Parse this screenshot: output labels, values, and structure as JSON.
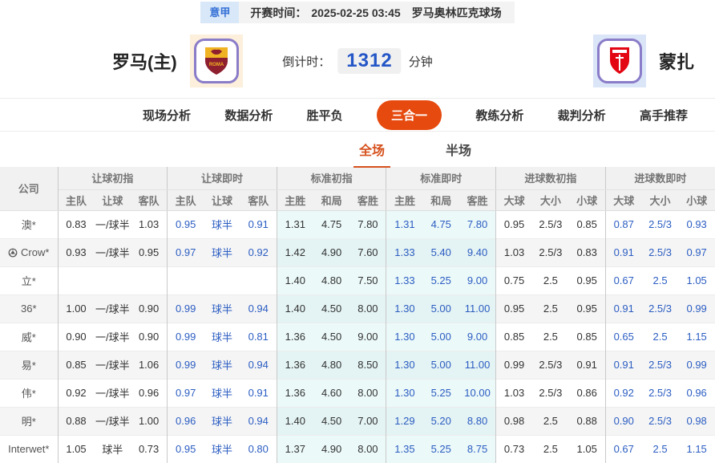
{
  "top_bar": {
    "league": "意甲",
    "kickoff_label": "开赛时间：",
    "kickoff_time": "2025-02-25 03:45",
    "venue": "罗马奥林匹克球场"
  },
  "header": {
    "home_team": "罗马(主)",
    "away_team": "蒙扎",
    "countdown_label": "倒计时：",
    "countdown_value": "1312",
    "countdown_unit": "分钟"
  },
  "nav": {
    "items": [
      {
        "label": "现场分析",
        "active": false
      },
      {
        "label": "数据分析",
        "active": false
      },
      {
        "label": "胜平负",
        "active": false
      },
      {
        "label": "三合一",
        "active": true
      },
      {
        "label": "教练分析",
        "active": false
      },
      {
        "label": "裁判分析",
        "active": false
      },
      {
        "label": "高手推荐",
        "active": false
      }
    ]
  },
  "sub_tabs": {
    "items": [
      {
        "label": "全场",
        "active": true
      },
      {
        "label": "半场",
        "active": false
      }
    ]
  },
  "odds_table": {
    "company_header": "公司",
    "groups": [
      {
        "label": "让球初指",
        "cols": [
          "主队",
          "让球",
          "客队"
        ],
        "live": false,
        "cyan": false
      },
      {
        "label": "让球即时",
        "cols": [
          "主队",
          "让球",
          "客队"
        ],
        "live": true,
        "cyan": false
      },
      {
        "label": "标准初指",
        "cols": [
          "主胜",
          "和局",
          "客胜"
        ],
        "live": false,
        "cyan": true
      },
      {
        "label": "标准即时",
        "cols": [
          "主胜",
          "和局",
          "客胜"
        ],
        "live": true,
        "cyan": true
      },
      {
        "label": "进球数初指",
        "cols": [
          "大球",
          "大小",
          "小球"
        ],
        "live": false,
        "cyan": false
      },
      {
        "label": "进球数即时",
        "cols": [
          "大球",
          "大小",
          "小球"
        ],
        "live": true,
        "cyan": false
      }
    ],
    "rows": [
      {
        "company": "澳*",
        "icon": "",
        "cells": [
          "0.83",
          "一/球半",
          "1.03",
          "0.95",
          "球半",
          "0.91",
          "1.31",
          "4.75",
          "7.80",
          "1.31",
          "4.75",
          "7.80",
          "0.95",
          "2.5/3",
          "0.85",
          "0.87",
          "2.5/3",
          "0.93"
        ]
      },
      {
        "company": "Crow*",
        "icon": "soccer-ball-icon",
        "cells": [
          "0.93",
          "一/球半",
          "0.95",
          "0.97",
          "球半",
          "0.92",
          "1.42",
          "4.90",
          "7.60",
          "1.33",
          "5.40",
          "9.40",
          "1.03",
          "2.5/3",
          "0.83",
          "0.91",
          "2.5/3",
          "0.97"
        ]
      },
      {
        "company": "立*",
        "icon": "",
        "cells": [
          "",
          "",
          "",
          "",
          "",
          "",
          "1.40",
          "4.80",
          "7.50",
          "1.33",
          "5.25",
          "9.00",
          "0.75",
          "2.5",
          "0.95",
          "0.67",
          "2.5",
          "1.05"
        ]
      },
      {
        "company": "36*",
        "icon": "",
        "cells": [
          "1.00",
          "一/球半",
          "0.90",
          "0.99",
          "球半",
          "0.94",
          "1.40",
          "4.50",
          "8.00",
          "1.30",
          "5.00",
          "11.00",
          "0.95",
          "2.5",
          "0.95",
          "0.91",
          "2.5/3",
          "0.99"
        ]
      },
      {
        "company": "威*",
        "icon": "",
        "cells": [
          "0.90",
          "一/球半",
          "0.90",
          "0.99",
          "球半",
          "0.81",
          "1.36",
          "4.50",
          "9.00",
          "1.30",
          "5.00",
          "9.00",
          "0.85",
          "2.5",
          "0.85",
          "0.65",
          "2.5",
          "1.15"
        ]
      },
      {
        "company": "易*",
        "icon": "",
        "cells": [
          "0.85",
          "一/球半",
          "1.06",
          "0.99",
          "球半",
          "0.94",
          "1.36",
          "4.80",
          "8.50",
          "1.30",
          "5.00",
          "11.00",
          "0.99",
          "2.5/3",
          "0.91",
          "0.91",
          "2.5/3",
          "0.99"
        ]
      },
      {
        "company": "伟*",
        "icon": "",
        "cells": [
          "0.92",
          "一/球半",
          "0.96",
          "0.97",
          "球半",
          "0.91",
          "1.36",
          "4.60",
          "8.00",
          "1.30",
          "5.25",
          "10.00",
          "1.03",
          "2.5/3",
          "0.86",
          "0.92",
          "2.5/3",
          "0.96"
        ]
      },
      {
        "company": "明*",
        "icon": "",
        "cells": [
          "0.88",
          "一/球半",
          "1.00",
          "0.96",
          "球半",
          "0.94",
          "1.40",
          "4.50",
          "7.00",
          "1.29",
          "5.20",
          "8.80",
          "0.98",
          "2.5",
          "0.88",
          "0.90",
          "2.5/3",
          "0.98"
        ]
      },
      {
        "company": "Interwet*",
        "icon": "",
        "cells": [
          "1.05",
          "球半",
          "0.73",
          "0.95",
          "球半",
          "0.80",
          "1.37",
          "4.90",
          "8.00",
          "1.35",
          "5.25",
          "8.75",
          "0.73",
          "2.5",
          "1.05",
          "0.67",
          "2.5",
          "1.15"
        ]
      }
    ]
  },
  "colors": {
    "accent_pill": "#e64a0e",
    "subtab_active": "#d6511d",
    "live_odds_blue": "#2b5dc2",
    "countdown_blue": "#2456c7",
    "league_badge_bg": "#d9e8f9",
    "league_badge_text": "#3470d6",
    "standard_col_bg": "#ecf9f9"
  }
}
